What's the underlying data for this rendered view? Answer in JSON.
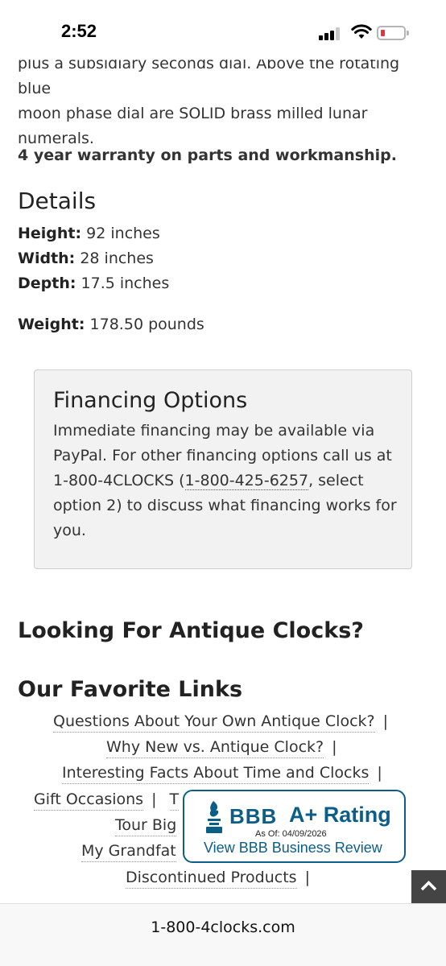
{
  "status": {
    "time": "2:52"
  },
  "description": {
    "clipped_line": "plus a subsidiary seconds dial. Above the rotating blue",
    "line2": "moon phase dial are SOLID brass milled lunar",
    "line3": "numerals."
  },
  "warranty": "4 year warranty on parts and workmanship.",
  "details": {
    "title": "Details",
    "height_label": "Height:",
    "height_value": "92 inches",
    "width_label": "Width:",
    "width_value": "28 inches",
    "depth_label": "Depth:",
    "depth_value": "17.5 inches",
    "weight_label": "Weight:",
    "weight_value": "178.50 pounds"
  },
  "financing": {
    "title": "Financing Options",
    "text_before": "Immediate financing may be available via PayPal. For other financing options call us at 1-800-4CLOCKS (",
    "phone": "1-800-425-6257",
    "text_after": ", select option 2) to discuss what financing works for you."
  },
  "antique_heading": "Looking For Antique Clocks?",
  "links": {
    "title": "Our Favorite Links",
    "separator": "|",
    "items": [
      "Questions About Your Own Antique Clock?",
      "Why New vs. Antique Clock?",
      "Interesting Facts About Time and Clocks",
      "Gift Occasions",
      "T",
      "Tour Big",
      "My Grandfat",
      "Discontinued Products"
    ]
  },
  "bbb": {
    "logo": "BBB",
    "rating": "A+ Rating",
    "date": "As Of: 04/09/2026",
    "review": "View BBB Business Review",
    "color": "#0d5e86"
  },
  "url_bar": {
    "url": "1-800-4clocks.com"
  }
}
